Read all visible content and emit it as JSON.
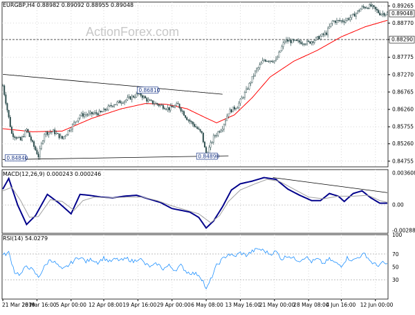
{
  "header": {
    "main": "EURGBP,H4  0.88982 0.89092 0.88955 0.89048",
    "macd": "MACD(12,26,9) 0.000243 0.000246",
    "rsi": "RSI(14) 54.0279"
  },
  "watermark": "ActionForex.com",
  "colors": {
    "candle": "#2f4f4f",
    "sma": "#ff0000",
    "trendline": "#000000",
    "macd": "#00008b",
    "signal": "#a0a0a0",
    "rsi": "#1e90ff"
  },
  "chart_data": [
    {
      "type": "candlestick",
      "panel": "price",
      "title": "EURGBP,H4",
      "ylim": [
        0.8459,
        0.8938
      ],
      "yticks": [
        "0.89265",
        "0.88770",
        "0.88290",
        "0.87775",
        "0.87270",
        "0.86765",
        "0.86260",
        "0.85755",
        "0.85260",
        "0.84755"
      ],
      "current_price_label": "0.89048",
      "horizontal_line_label": "0.88290",
      "annotations": [
        "0.86810",
        "0.84840",
        "0.84890"
      ],
      "moving_average": "red line",
      "ohlc_anchors": [
        {
          "x": 0,
          "close": 0.8695
        },
        {
          "x": 6,
          "close": 0.8555
        },
        {
          "x": 12,
          "close": 0.8536
        },
        {
          "x": 16,
          "close": 0.8567
        },
        {
          "x": 20,
          "close": 0.8527
        },
        {
          "x": 24,
          "close": 0.849
        },
        {
          "x": 28,
          "close": 0.8557
        },
        {
          "x": 34,
          "close": 0.8562
        },
        {
          "x": 40,
          "close": 0.8541
        },
        {
          "x": 46,
          "close": 0.8574
        },
        {
          "x": 52,
          "close": 0.8609
        },
        {
          "x": 58,
          "close": 0.8612
        },
        {
          "x": 66,
          "close": 0.8616
        },
        {
          "x": 74,
          "close": 0.864
        },
        {
          "x": 82,
          "close": 0.8652
        },
        {
          "x": 88,
          "close": 0.8664
        },
        {
          "x": 92,
          "close": 0.8672
        },
        {
          "x": 98,
          "close": 0.865
        },
        {
          "x": 104,
          "close": 0.8641
        },
        {
          "x": 112,
          "close": 0.8628
        },
        {
          "x": 118,
          "close": 0.864
        },
        {
          "x": 124,
          "close": 0.86
        },
        {
          "x": 130,
          "close": 0.8575
        },
        {
          "x": 134,
          "close": 0.8555
        },
        {
          "x": 137,
          "close": 0.8492
        },
        {
          "x": 142,
          "close": 0.8545
        },
        {
          "x": 148,
          "close": 0.8575
        },
        {
          "x": 152,
          "close": 0.8618
        },
        {
          "x": 158,
          "close": 0.8636
        },
        {
          "x": 164,
          "close": 0.868
        },
        {
          "x": 170,
          "close": 0.8735
        },
        {
          "x": 176,
          "close": 0.877
        },
        {
          "x": 184,
          "close": 0.8768
        },
        {
          "x": 190,
          "close": 0.8826
        },
        {
          "x": 198,
          "close": 0.8822
        },
        {
          "x": 206,
          "close": 0.882
        },
        {
          "x": 212,
          "close": 0.8833
        },
        {
          "x": 218,
          "close": 0.8848
        },
        {
          "x": 222,
          "close": 0.8882
        },
        {
          "x": 230,
          "close": 0.8884
        },
        {
          "x": 236,
          "close": 0.8898
        },
        {
          "x": 242,
          "close": 0.8922
        },
        {
          "x": 248,
          "close": 0.8926
        },
        {
          "x": 254,
          "close": 0.8905
        },
        {
          "x": 259,
          "close": 0.8905
        }
      ],
      "sma_anchors": [
        {
          "x": 0,
          "v": 0.857
        },
        {
          "x": 20,
          "v": 0.8561
        },
        {
          "x": 40,
          "v": 0.8563
        },
        {
          "x": 60,
          "v": 0.86
        },
        {
          "x": 80,
          "v": 0.8628
        },
        {
          "x": 96,
          "v": 0.8643
        },
        {
          "x": 110,
          "v": 0.8641
        },
        {
          "x": 124,
          "v": 0.8628
        },
        {
          "x": 136,
          "v": 0.8603
        },
        {
          "x": 144,
          "v": 0.8587
        },
        {
          "x": 156,
          "v": 0.861
        },
        {
          "x": 168,
          "v": 0.866
        },
        {
          "x": 180,
          "v": 0.872
        },
        {
          "x": 196,
          "v": 0.8766
        },
        {
          "x": 212,
          "v": 0.8798
        },
        {
          "x": 228,
          "v": 0.8837
        },
        {
          "x": 244,
          "v": 0.8866
        },
        {
          "x": 259,
          "v": 0.8885
        }
      ],
      "trendlines": [
        {
          "from": {
            "x": 0,
            "v": 0.8728
          },
          "to": {
            "x": 148,
            "v": 0.867
          }
        },
        {
          "from": {
            "x": 0,
            "v": 0.848
          },
          "to": {
            "x": 152,
            "v": 0.8491
          }
        }
      ]
    },
    {
      "type": "line",
      "panel": "macd",
      "title": "MACD(12,26,9)",
      "ylim": [
        -0.0032,
        0.004
      ],
      "yticks": [
        "0.003608",
        "0.00",
        "-0.002886"
      ],
      "series": [
        {
          "name": "MACD",
          "values": [
            {
              "x": 0,
              "v": 0.0018
            },
            {
              "x": 4,
              "v": 0.003
            },
            {
              "x": 10,
              "v": 0.0
            },
            {
              "x": 16,
              "v": -0.0022
            },
            {
              "x": 22,
              "v": -0.0012
            },
            {
              "x": 30,
              "v": 0.0012
            },
            {
              "x": 38,
              "v": 0.0002
            },
            {
              "x": 46,
              "v": -0.001
            },
            {
              "x": 52,
              "v": 0.0012
            },
            {
              "x": 58,
              "v": 0.0011
            },
            {
              "x": 66,
              "v": 0.0009
            },
            {
              "x": 74,
              "v": 0.0008
            },
            {
              "x": 82,
              "v": 0.001
            },
            {
              "x": 90,
              "v": 0.0011
            },
            {
              "x": 98,
              "v": 0.0007
            },
            {
              "x": 106,
              "v": 0.0003
            },
            {
              "x": 114,
              "v": -0.0004
            },
            {
              "x": 120,
              "v": -0.0006
            },
            {
              "x": 126,
              "v": -0.0008
            },
            {
              "x": 132,
              "v": -0.0014
            },
            {
              "x": 137,
              "v": -0.0026
            },
            {
              "x": 142,
              "v": -0.0018
            },
            {
              "x": 148,
              "v": -0.0002
            },
            {
              "x": 154,
              "v": 0.0017
            },
            {
              "x": 160,
              "v": 0.0024
            },
            {
              "x": 168,
              "v": 0.0027
            },
            {
              "x": 176,
              "v": 0.0031
            },
            {
              "x": 184,
              "v": 0.0029
            },
            {
              "x": 192,
              "v": 0.0018
            },
            {
              "x": 200,
              "v": 0.0011
            },
            {
              "x": 208,
              "v": 0.0005
            },
            {
              "x": 214,
              "v": 0.0005
            },
            {
              "x": 220,
              "v": 0.0013
            },
            {
              "x": 226,
              "v": 0.001
            },
            {
              "x": 230,
              "v": 0.0004
            },
            {
              "x": 236,
              "v": 0.0013
            },
            {
              "x": 242,
              "v": 0.0016
            },
            {
              "x": 248,
              "v": 0.0008
            },
            {
              "x": 254,
              "v": 0.0002
            },
            {
              "x": 259,
              "v": 0.0002
            }
          ]
        },
        {
          "name": "Signal",
          "values": [
            {
              "x": 0,
              "v": 0.0016
            },
            {
              "x": 6,
              "v": 0.002
            },
            {
              "x": 12,
              "v": 0.0005
            },
            {
              "x": 18,
              "v": -0.0014
            },
            {
              "x": 24,
              "v": -0.0013
            },
            {
              "x": 32,
              "v": 0.0006
            },
            {
              "x": 40,
              "v": 0.0004
            },
            {
              "x": 48,
              "v": -0.0006
            },
            {
              "x": 54,
              "v": 0.0005
            },
            {
              "x": 62,
              "v": 0.0009
            },
            {
              "x": 72,
              "v": 0.0008
            },
            {
              "x": 84,
              "v": 0.0009
            },
            {
              "x": 94,
              "v": 0.0009
            },
            {
              "x": 104,
              "v": 0.0005
            },
            {
              "x": 114,
              "v": -0.0001
            },
            {
              "x": 124,
              "v": -0.0006
            },
            {
              "x": 132,
              "v": -0.001
            },
            {
              "x": 140,
              "v": -0.002
            },
            {
              "x": 146,
              "v": -0.0012
            },
            {
              "x": 152,
              "v": 0.0004
            },
            {
              "x": 160,
              "v": 0.0017
            },
            {
              "x": 170,
              "v": 0.0024
            },
            {
              "x": 178,
              "v": 0.0029
            },
            {
              "x": 186,
              "v": 0.0027
            },
            {
              "x": 196,
              "v": 0.0018
            },
            {
              "x": 206,
              "v": 0.0009
            },
            {
              "x": 216,
              "v": 0.0007
            },
            {
              "x": 226,
              "v": 0.001
            },
            {
              "x": 236,
              "v": 0.001
            },
            {
              "x": 246,
              "v": 0.0011
            },
            {
              "x": 254,
              "v": 0.0005
            },
            {
              "x": 259,
              "v": 0.0003
            }
          ]
        }
      ],
      "trendline": {
        "from": {
          "x": 182,
          "v": 0.0031
        },
        "to": {
          "x": 259,
          "v": 0.0014
        }
      }
    },
    {
      "type": "line",
      "panel": "rsi",
      "title": "RSI(14)",
      "ylim": [
        0,
        100
      ],
      "yticks": [
        100,
        70,
        50,
        30,
        0
      ],
      "levels": [
        70,
        30
      ],
      "series": [
        {
          "name": "RSI",
          "values": [
            {
              "x": 0,
              "v": 68
            },
            {
              "x": 4,
              "v": 72
            },
            {
              "x": 8,
              "v": 42
            },
            {
              "x": 12,
              "v": 38
            },
            {
              "x": 16,
              "v": 52
            },
            {
              "x": 20,
              "v": 45
            },
            {
              "x": 24,
              "v": 34
            },
            {
              "x": 28,
              "v": 50
            },
            {
              "x": 32,
              "v": 62
            },
            {
              "x": 36,
              "v": 55
            },
            {
              "x": 40,
              "v": 45
            },
            {
              "x": 44,
              "v": 52
            },
            {
              "x": 48,
              "v": 60
            },
            {
              "x": 52,
              "v": 66
            },
            {
              "x": 56,
              "v": 58
            },
            {
              "x": 60,
              "v": 62
            },
            {
              "x": 64,
              "v": 57
            },
            {
              "x": 68,
              "v": 64
            },
            {
              "x": 72,
              "v": 58
            },
            {
              "x": 76,
              "v": 62
            },
            {
              "x": 80,
              "v": 60
            },
            {
              "x": 84,
              "v": 63
            },
            {
              "x": 88,
              "v": 58
            },
            {
              "x": 92,
              "v": 64
            },
            {
              "x": 96,
              "v": 54
            },
            {
              "x": 100,
              "v": 50
            },
            {
              "x": 104,
              "v": 55
            },
            {
              "x": 108,
              "v": 47
            },
            {
              "x": 112,
              "v": 52
            },
            {
              "x": 116,
              "v": 45
            },
            {
              "x": 120,
              "v": 52
            },
            {
              "x": 124,
              "v": 42
            },
            {
              "x": 128,
              "v": 40
            },
            {
              "x": 132,
              "v": 38
            },
            {
              "x": 135,
              "v": 28
            },
            {
              "x": 137,
              "v": 14
            },
            {
              "x": 140,
              "v": 30
            },
            {
              "x": 144,
              "v": 52
            },
            {
              "x": 148,
              "v": 62
            },
            {
              "x": 152,
              "v": 70
            },
            {
              "x": 156,
              "v": 66
            },
            {
              "x": 160,
              "v": 72
            },
            {
              "x": 164,
              "v": 68
            },
            {
              "x": 168,
              "v": 74
            },
            {
              "x": 172,
              "v": 78
            },
            {
              "x": 176,
              "v": 75
            },
            {
              "x": 180,
              "v": 70
            },
            {
              "x": 184,
              "v": 74
            },
            {
              "x": 188,
              "v": 62
            },
            {
              "x": 192,
              "v": 68
            },
            {
              "x": 196,
              "v": 63
            },
            {
              "x": 200,
              "v": 60
            },
            {
              "x": 204,
              "v": 66
            },
            {
              "x": 208,
              "v": 58
            },
            {
              "x": 212,
              "v": 62
            },
            {
              "x": 216,
              "v": 55
            },
            {
              "x": 220,
              "v": 62
            },
            {
              "x": 224,
              "v": 56
            },
            {
              "x": 228,
              "v": 52
            },
            {
              "x": 232,
              "v": 64
            },
            {
              "x": 236,
              "v": 60
            },
            {
              "x": 240,
              "v": 66
            },
            {
              "x": 244,
              "v": 70
            },
            {
              "x": 248,
              "v": 58
            },
            {
              "x": 252,
              "v": 52
            },
            {
              "x": 256,
              "v": 56
            },
            {
              "x": 259,
              "v": 54
            }
          ]
        }
      ]
    }
  ],
  "x_axis": {
    "bars": 260,
    "labels": [
      {
        "x": 0,
        "text": "21 Mar 2019"
      },
      {
        "x": 23,
        "text": "28 Mar 16:00"
      },
      {
        "x": 46,
        "text": "5 Apr 00:00"
      },
      {
        "x": 68,
        "text": "12 Apr 08:00"
      },
      {
        "x": 91,
        "text": "19 Apr 16:00"
      },
      {
        "x": 114,
        "text": "29 Apr 00:00"
      },
      {
        "x": 137,
        "text": "6 May 08:00"
      },
      {
        "x": 160,
        "text": "13 May 16:00"
      },
      {
        "x": 183,
        "text": "21 May 00:00"
      },
      {
        "x": 206,
        "text": "28 May 08:00"
      },
      {
        "x": 228,
        "text": "4 Jun 16:00"
      },
      {
        "x": 251,
        "text": "12 Jun 00:00"
      }
    ]
  }
}
